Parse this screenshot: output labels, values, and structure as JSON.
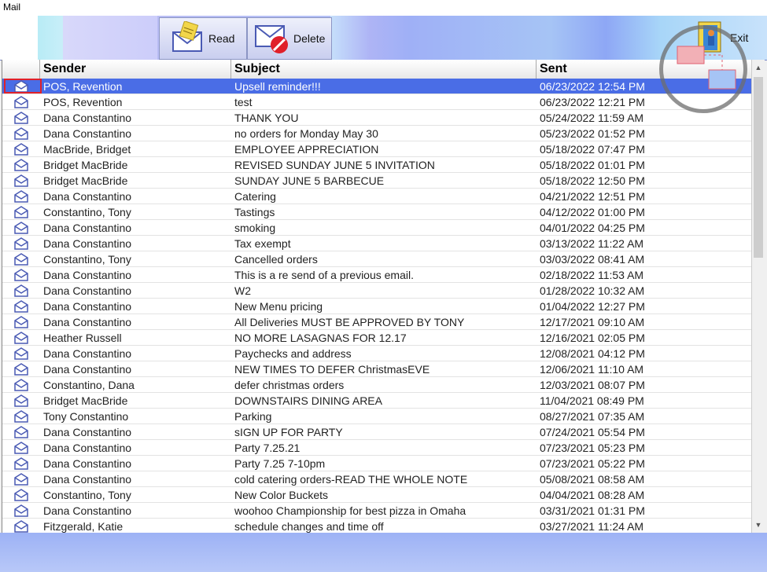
{
  "window": {
    "title": "Mail"
  },
  "toolbar": {
    "read_label": "Read",
    "delete_label": "Delete",
    "exit_label": "Exit"
  },
  "table": {
    "columns": [
      "Sender",
      "Subject",
      "Sent"
    ],
    "rows": [
      {
        "sender": "POS, Revention",
        "subject": "Upsell reminder!!!",
        "sent": "06/23/2022 12:54 PM"
      },
      {
        "sender": "POS, Revention",
        "subject": "test",
        "sent": "06/23/2022 12:21 PM"
      },
      {
        "sender": "Dana Constantino",
        "subject": "THANK YOU",
        "sent": "05/24/2022 11:59 AM"
      },
      {
        "sender": "Dana Constantino",
        "subject": "no orders for Monday May 30",
        "sent": "05/23/2022 01:52 PM"
      },
      {
        "sender": "MacBride, Bridget",
        "subject": "EMPLOYEE APPRECIATION",
        "sent": "05/18/2022 07:47 PM"
      },
      {
        "sender": "Bridget MacBride",
        "subject": "REVISED SUNDAY JUNE 5 INVITATION",
        "sent": "05/18/2022 01:01 PM"
      },
      {
        "sender": "Bridget MacBride",
        "subject": "SUNDAY JUNE 5 BARBECUE",
        "sent": "05/18/2022 12:50 PM"
      },
      {
        "sender": "Dana Constantino",
        "subject": "Catering",
        "sent": "04/21/2022 12:51 PM"
      },
      {
        "sender": "Constantino, Tony",
        "subject": "Tastings",
        "sent": "04/12/2022 01:00 PM"
      },
      {
        "sender": "Dana Constantino",
        "subject": "smoking",
        "sent": "04/01/2022 04:25 PM"
      },
      {
        "sender": "Dana Constantino",
        "subject": "Tax exempt",
        "sent": "03/13/2022 11:22 AM"
      },
      {
        "sender": "Constantino, Tony",
        "subject": "Cancelled orders",
        "sent": "03/03/2022 08:41 AM"
      },
      {
        "sender": "Dana Constantino",
        "subject": "This is a re send of a previous email.",
        "sent": "02/18/2022 11:53 AM"
      },
      {
        "sender": "Dana Constantino",
        "subject": "W2",
        "sent": "01/28/2022 10:32 AM"
      },
      {
        "sender": "Dana Constantino",
        "subject": "New Menu pricing",
        "sent": "01/04/2022 12:27 PM"
      },
      {
        "sender": "Dana Constantino",
        "subject": "All Deliveries MUST BE APPROVED BY TONY",
        "sent": "12/17/2021 09:10 AM"
      },
      {
        "sender": "Heather Russell",
        "subject": "NO MORE LASAGNAS FOR 12.17",
        "sent": "12/16/2021 02:05 PM"
      },
      {
        "sender": "Dana Constantino",
        "subject": "Paychecks and address",
        "sent": "12/08/2021 04:12 PM"
      },
      {
        "sender": "Dana Constantino",
        "subject": "NEW TIMES TO DEFER ChristmasEVE",
        "sent": "12/06/2021 11:10 AM"
      },
      {
        "sender": "Constantino, Dana",
        "subject": "defer christmas orders",
        "sent": "12/03/2021 08:07 PM"
      },
      {
        "sender": "Bridget MacBride",
        "subject": "DOWNSTAIRS DINING AREA",
        "sent": "11/04/2021 08:49 PM"
      },
      {
        "sender": "Tony Constantino",
        "subject": "Parking",
        "sent": "08/27/2021 07:35 AM"
      },
      {
        "sender": "Dana Constantino",
        "subject": "sIGN UP FOR PARTY",
        "sent": "07/24/2021 05:54 PM"
      },
      {
        "sender": "Dana Constantino",
        "subject": "Party 7.25.21",
        "sent": "07/23/2021 05:23 PM"
      },
      {
        "sender": "Dana Constantino",
        "subject": "Party 7.25  7-10pm",
        "sent": "07/23/2021 05:22 PM"
      },
      {
        "sender": "Dana Constantino",
        "subject": "cold catering orders-READ THE WHOLE NOTE",
        "sent": "05/08/2021 08:58 AM"
      },
      {
        "sender": "Constantino, Tony",
        "subject": "New Color Buckets",
        "sent": "04/04/2021 08:28 AM"
      },
      {
        "sender": "Dana Constantino",
        "subject": "woohoo Championship for best pizza in Omaha",
        "sent": "03/31/2021 01:31 PM"
      },
      {
        "sender": "Fitzgerald, Katie",
        "subject": "schedule changes and time off",
        "sent": "03/27/2021 11:24 AM"
      }
    ]
  },
  "colors": {
    "selected_row": "#4a6de6",
    "selection_outline": "#e0202a",
    "toolbar_accent": "#aeb4f5"
  },
  "icons": [
    "envelope-open-icon",
    "envelope-read-icon",
    "envelope-delete-icon",
    "exit-door-icon"
  ]
}
